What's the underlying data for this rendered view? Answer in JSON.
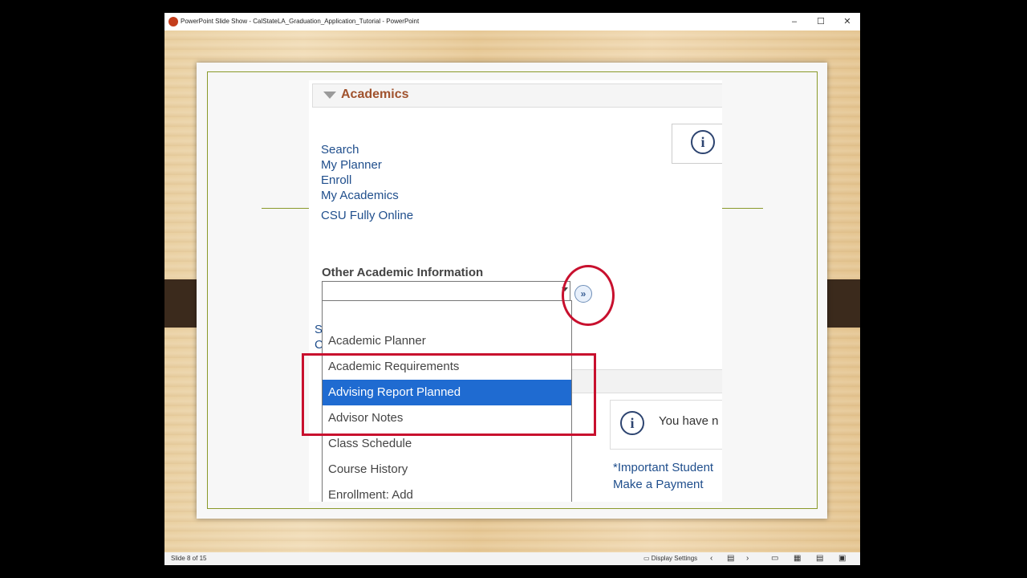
{
  "window": {
    "title": "PowerPoint Slide Show  -  CalStateLA_Graduation_Application_Tutorial - PowerPoint",
    "buttons": {
      "minimize": "–",
      "maximize": "☐",
      "close": "✕"
    }
  },
  "academics": {
    "header": "Academics",
    "links": [
      "Search",
      "My Planner",
      "Enroll",
      "My Academics",
      "CSU Fully Online"
    ],
    "other_label": "Other Academic Information",
    "select_value": "",
    "go_button": "»",
    "options": [
      "Academic Planner",
      "Academic Requirements",
      "Advising Report Planned",
      "Advisor Notes",
      "Class Schedule",
      "Course History",
      "Enrollment: Add"
    ],
    "selected_option": "Advising Report Planned"
  },
  "background_fragments": {
    "s": "S",
    "c": "C",
    "you_have": "You have n",
    "important": "*Important Student",
    "payment": "Make a Payment"
  },
  "icons": {
    "info": "i",
    "chevron_left": "‹",
    "chevron_right": "›",
    "normal_view": "▭",
    "slide_sorter": "▦",
    "reading_view": "▤",
    "slideshow": "▣"
  },
  "statusbar": {
    "slide_number": "Slide 8 of 15",
    "display_settings": "Display Settings"
  },
  "colors": {
    "selection": "#1f6bd1",
    "annotation_red": "#c8102e",
    "link_blue": "#1f4e8c",
    "header_brown": "#a0522d"
  }
}
